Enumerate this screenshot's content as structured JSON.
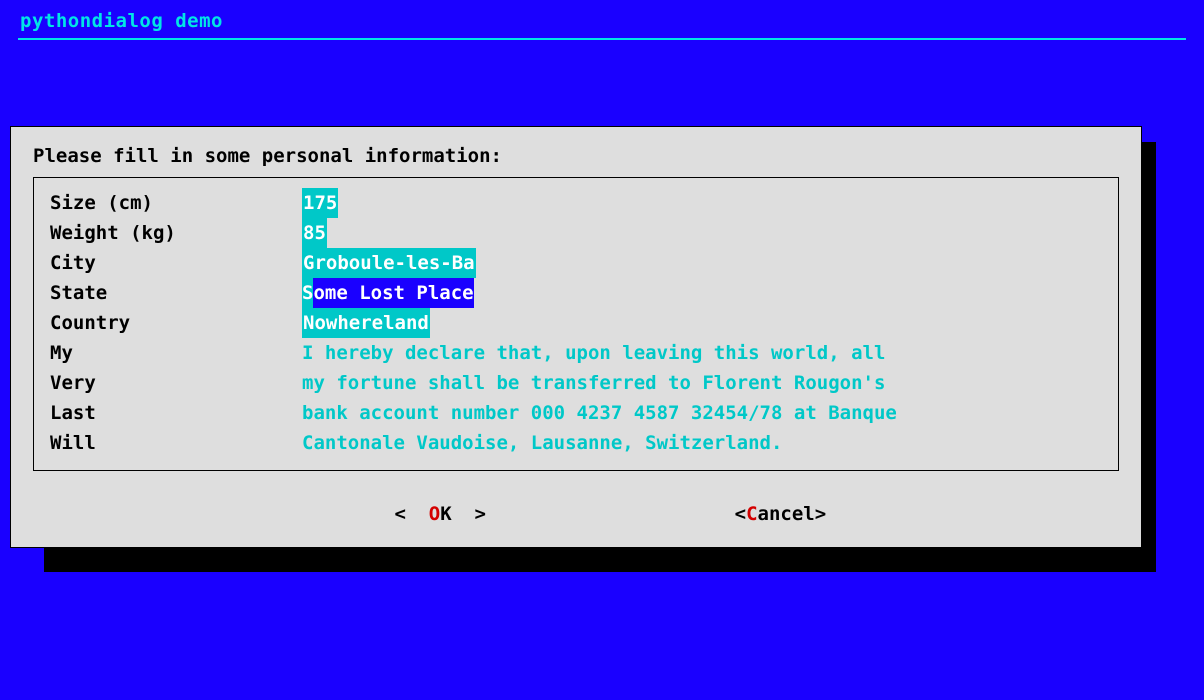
{
  "header": {
    "title": "pythondialog demo"
  },
  "dialog": {
    "prompt": "Please fill in some personal information:",
    "fields": {
      "size": {
        "label": "Size (cm)",
        "value": "175"
      },
      "weight": {
        "label": "Weight (kg)",
        "value": "85"
      },
      "city": {
        "label": "City",
        "value": "Groboule-les-Ba"
      },
      "state": {
        "label": "State",
        "value_first": "S",
        "value_rest": "ome Lost Place"
      },
      "country": {
        "label": "Country",
        "value": "Nowhereland"
      }
    },
    "will": {
      "labels": [
        "My",
        "Very",
        "Last",
        "Will"
      ],
      "lines": [
        "I hereby declare that, upon leaving this world, all",
        "my fortune shall be transferred to Florent Rougon's",
        "bank account number 000 4237 4587 32454/78 at Banque",
        "Cantonale Vaudoise, Lausanne, Switzerland."
      ]
    },
    "buttons": {
      "ok": {
        "open": "<  ",
        "hotkey": "O",
        "rest": "K",
        "close": "  >"
      },
      "cancel": {
        "open": "<",
        "hotkey": "C",
        "rest": "ancel",
        "close": ">"
      }
    }
  }
}
